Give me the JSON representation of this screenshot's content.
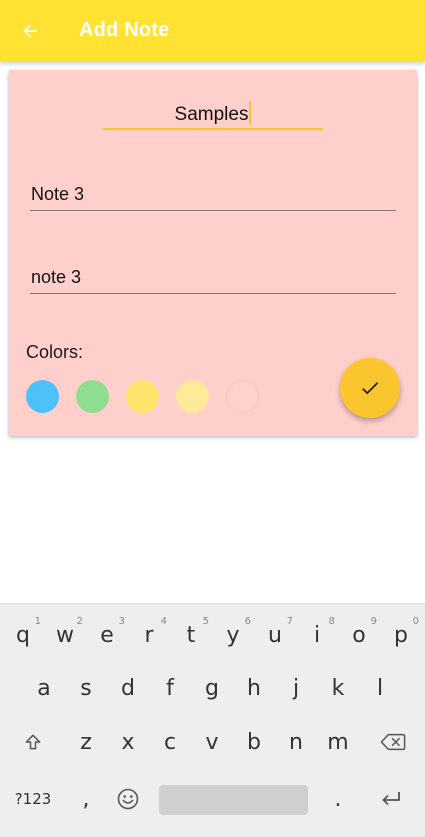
{
  "appbar": {
    "title": "Add Note",
    "back_icon": "arrow-left-icon",
    "background": "#FFE232"
  },
  "note": {
    "category": "Samples",
    "title": "Note 3",
    "content": "note 3",
    "card_color": "#FFCFCB",
    "colors_label": "Colors:",
    "swatches": [
      "#4EC1FB",
      "#8EDE8F",
      "#FFE46B",
      "#FFEA9A",
      "#FFD2CD"
    ],
    "save_icon": "check-icon",
    "accent": "#FBC52D"
  },
  "keyboard": {
    "row1": [
      {
        "key": "q",
        "hint": "1"
      },
      {
        "key": "w",
        "hint": "2"
      },
      {
        "key": "e",
        "hint": "3"
      },
      {
        "key": "r",
        "hint": "4"
      },
      {
        "key": "t",
        "hint": "5"
      },
      {
        "key": "y",
        "hint": "6"
      },
      {
        "key": "u",
        "hint": "7"
      },
      {
        "key": "i",
        "hint": "8"
      },
      {
        "key": "o",
        "hint": "9"
      },
      {
        "key": "p",
        "hint": "0"
      }
    ],
    "row2": [
      "a",
      "s",
      "d",
      "f",
      "g",
      "h",
      "j",
      "k",
      "l"
    ],
    "row3": [
      "z",
      "x",
      "c",
      "v",
      "b",
      "n",
      "m"
    ],
    "symbols": "?123",
    "comma": ",",
    "period": ".",
    "shift_icon": "shift-icon",
    "backspace_icon": "backspace-icon",
    "emoji_icon": "emoji-icon",
    "enter_icon": "enter-icon"
  }
}
